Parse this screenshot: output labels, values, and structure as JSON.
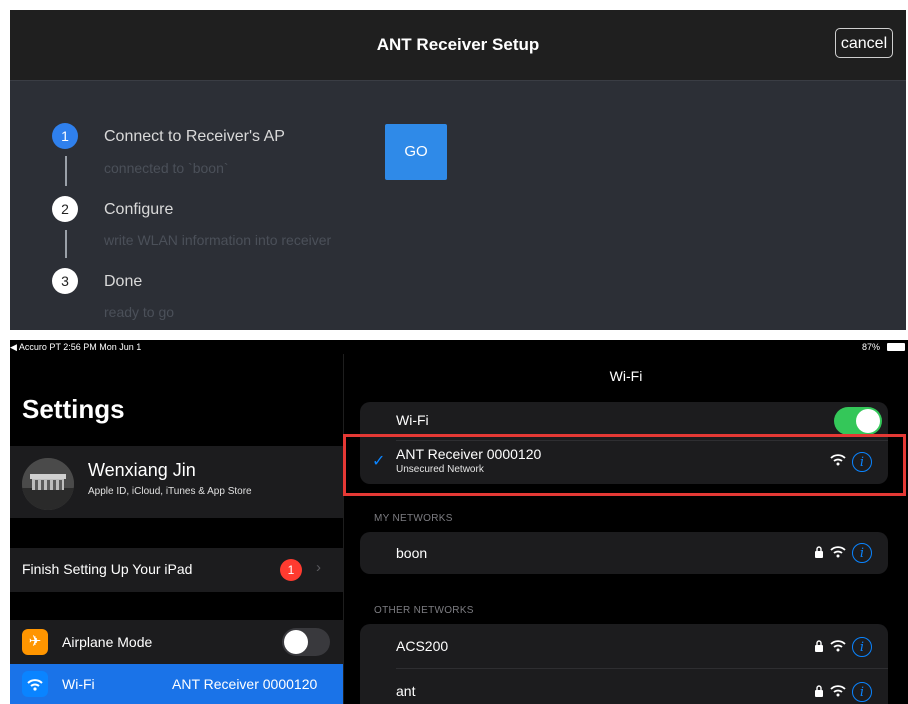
{
  "setup": {
    "title": "ANT Receiver Setup",
    "cancel_label": "cancel",
    "go_label": "GO",
    "steps": [
      {
        "number": "1",
        "title": "Connect to Receiver's AP",
        "subtitle": "connected to `boon`"
      },
      {
        "number": "2",
        "title": "Configure",
        "subtitle": "write WLAN information into receiver"
      },
      {
        "number": "3",
        "title": "Done",
        "subtitle": "ready to go"
      }
    ]
  },
  "status_bar": {
    "left": "◀ Accuro PT   2:56 PM   Mon Jun 1",
    "battery": "87%"
  },
  "sidebar": {
    "title": "Settings",
    "profile": {
      "name": "Wenxiang Jin",
      "subtitle": "Apple ID, iCloud, iTunes & App Store"
    },
    "finish_setup": {
      "label": "Finish Setting Up Your iPad",
      "badge": "1"
    },
    "airplane": {
      "label": "Airplane Mode"
    },
    "wifi": {
      "label": "Wi-Fi",
      "value": "ANT Receiver 0000120"
    }
  },
  "wifi_panel": {
    "title": "Wi-Fi",
    "toggle_label": "Wi-Fi",
    "connected": {
      "name": "ANT Receiver 0000120",
      "status": "Unsecured Network"
    },
    "my_networks_header": "MY NETWORKS",
    "my_networks": [
      "boon"
    ],
    "other_networks_header": "OTHER NETWORKS",
    "other_networks": [
      "ACS200",
      "ant"
    ]
  },
  "icons": {
    "check": "✓",
    "chevron": "›",
    "info": "i",
    "airplane": "✈",
    "lock": "🔒"
  },
  "colors": {
    "accent_blue": "#0a84ff",
    "toggle_on": "#34c759",
    "badge_red": "#ff3b30",
    "highlight_red": "#e53935"
  }
}
